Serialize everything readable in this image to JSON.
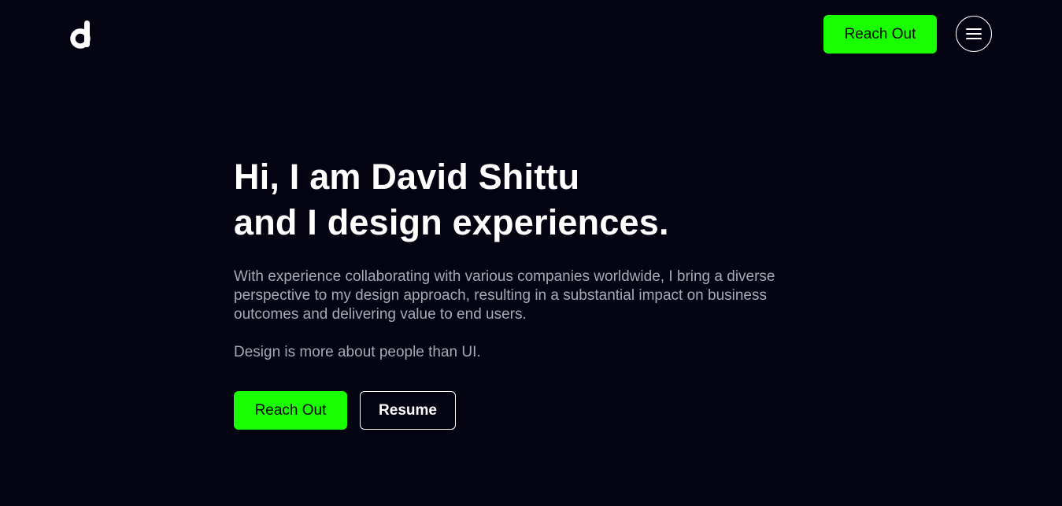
{
  "header": {
    "logo_icon": "d-letter-logo-icon",
    "cta_label": "Reach Out",
    "menu_icon": "hamburger-menu-icon"
  },
  "hero": {
    "title_line1": "Hi, I am David Shittu",
    "title_line2": "and I design experiences.",
    "description": "With experience collaborating with various companies worldwide, I bring a diverse perspective to my design approach, resulting in a substantial impact on business outcomes and delivering value to end users.",
    "tagline": "Design is more about people than UI.",
    "primary_button": "Reach Out",
    "secondary_button": "Resume"
  },
  "colors": {
    "background": "#030312",
    "accent": "#1aff00",
    "text_primary": "#ffffff",
    "text_muted": "#a9a9b4"
  }
}
